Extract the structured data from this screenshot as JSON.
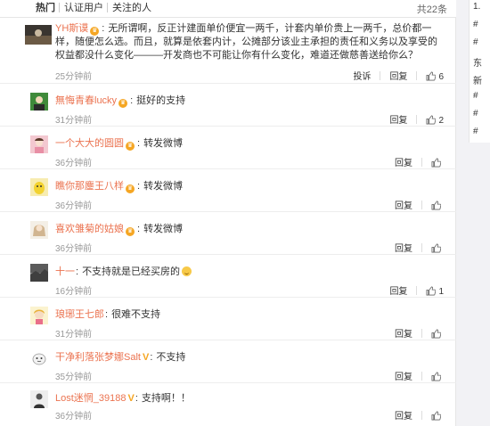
{
  "tabs": [
    {
      "label": "热门",
      "active": true
    },
    {
      "label": "认证用户",
      "active": false
    },
    {
      "label": "关注的人",
      "active": false
    }
  ],
  "total": "共22条",
  "comments": [
    {
      "user": "YH斯谟",
      "badge": "crown",
      "text": "无所谓啊，反正计建面单价便宜一两千，计套内单价贵上一两千，总价都一样，随便怎么选。而且，就算是依套内计，公摊部分该业主承担的责任和义务以及享受的权益都没什么变化———开发商也不可能让你有什么变化，难道还做慈善送给你么？",
      "time": "25分钟前",
      "report": "投诉",
      "reply": "回复",
      "likes": "6"
    },
    {
      "user": "無悔青春lucky",
      "badge": "crown",
      "text": "挺好的支持",
      "time": "31分钟前",
      "reply": "回复",
      "likes": "2"
    },
    {
      "user": "一个大大的圆圆",
      "badge": "crown",
      "text": "转发微博",
      "time": "36分钟前",
      "reply": "回复",
      "likes": ""
    },
    {
      "user": "瞧你那鏖王八样",
      "badge": "crown",
      "text": "转发微博",
      "time": "36分钟前",
      "reply": "回复",
      "likes": ""
    },
    {
      "user": "喜欢雏菊的姑娘",
      "badge": "crown",
      "text": "转发微博",
      "time": "36分钟前",
      "reply": "回复",
      "likes": ""
    },
    {
      "user": "十一",
      "badge": "",
      "text": "不支持就是已经买房的",
      "emoji": true,
      "time": "16分钟前",
      "reply": "回复",
      "likes": "1"
    },
    {
      "user": "琅琊王七郎",
      "badge": "",
      "text": "很难不支持",
      "time": "31分钟前",
      "reply": "回复",
      "likes": ""
    },
    {
      "user": "干净利落张梦娜Salt",
      "badge": "V",
      "text": "不支持",
      "time": "35分钟前",
      "reply": "回复",
      "likes": ""
    },
    {
      "user": "Lost迷惘_39188",
      "badge": "V",
      "text": "支持啊！！",
      "time": "36分钟前",
      "reply": "回复",
      "likes": ""
    }
  ],
  "sidebar": [
    "1.",
    "#",
    "#",
    "东",
    "新",
    "#",
    "#",
    "#"
  ],
  "colors": {
    "username": "#eb7350",
    "badge": "#f5a623",
    "time": "#999999"
  }
}
